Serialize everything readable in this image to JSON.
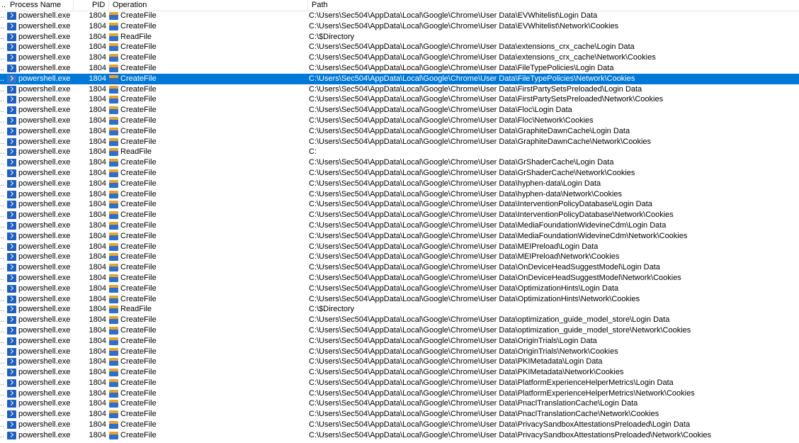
{
  "columns": {
    "process": "Process Name",
    "pid": "PID",
    "operation": "Operation",
    "path": "Path"
  },
  "rows": [
    {
      "process": "powershell.exe",
      "pid": "1804",
      "op": "CreateFile",
      "path": "C:\\Users\\Sec504\\AppData\\Local\\Google\\Chrome\\User Data\\EVWhitelist\\Login Data"
    },
    {
      "process": "powershell.exe",
      "pid": "1804",
      "op": "CreateFile",
      "path": "C:\\Users\\Sec504\\AppData\\Local\\Google\\Chrome\\User Data\\EVWhitelist\\Network\\Cookies"
    },
    {
      "process": "powershell.exe",
      "pid": "1804",
      "op": "ReadFile",
      "path": "C:\\$Directory"
    },
    {
      "process": "powershell.exe",
      "pid": "1804",
      "op": "CreateFile",
      "path": "C:\\Users\\Sec504\\AppData\\Local\\Google\\Chrome\\User Data\\extensions_crx_cache\\Login Data"
    },
    {
      "process": "powershell.exe",
      "pid": "1804",
      "op": "CreateFile",
      "path": "C:\\Users\\Sec504\\AppData\\Local\\Google\\Chrome\\User Data\\extensions_crx_cache\\Network\\Cookies"
    },
    {
      "process": "powershell.exe",
      "pid": "1804",
      "op": "CreateFile",
      "path": "C:\\Users\\Sec504\\AppData\\Local\\Google\\Chrome\\User Data\\FileTypePolicies\\Login Data"
    },
    {
      "process": "powershell.exe",
      "pid": "1804",
      "op": "CreateFile",
      "path": "C:\\Users\\Sec504\\AppData\\Local\\Google\\Chrome\\User Data\\FileTypePolicies\\Network\\Cookies",
      "selected": true
    },
    {
      "process": "powershell.exe",
      "pid": "1804",
      "op": "CreateFile",
      "path": "C:\\Users\\Sec504\\AppData\\Local\\Google\\Chrome\\User Data\\FirstPartySetsPreloaded\\Login Data"
    },
    {
      "process": "powershell.exe",
      "pid": "1804",
      "op": "CreateFile",
      "path": "C:\\Users\\Sec504\\AppData\\Local\\Google\\Chrome\\User Data\\FirstPartySetsPreloaded\\Network\\Cookies"
    },
    {
      "process": "powershell.exe",
      "pid": "1804",
      "op": "CreateFile",
      "path": "C:\\Users\\Sec504\\AppData\\Local\\Google\\Chrome\\User Data\\Floc\\Login Data"
    },
    {
      "process": "powershell.exe",
      "pid": "1804",
      "op": "CreateFile",
      "path": "C:\\Users\\Sec504\\AppData\\Local\\Google\\Chrome\\User Data\\Floc\\Network\\Cookies"
    },
    {
      "process": "powershell.exe",
      "pid": "1804",
      "op": "CreateFile",
      "path": "C:\\Users\\Sec504\\AppData\\Local\\Google\\Chrome\\User Data\\GraphiteDawnCache\\Login Data"
    },
    {
      "process": "powershell.exe",
      "pid": "1804",
      "op": "CreateFile",
      "path": "C:\\Users\\Sec504\\AppData\\Local\\Google\\Chrome\\User Data\\GraphiteDawnCache\\Network\\Cookies"
    },
    {
      "process": "powershell.exe",
      "pid": "1804",
      "op": "ReadFile",
      "path": "C:"
    },
    {
      "process": "powershell.exe",
      "pid": "1804",
      "op": "CreateFile",
      "path": "C:\\Users\\Sec504\\AppData\\Local\\Google\\Chrome\\User Data\\GrShaderCache\\Login Data"
    },
    {
      "process": "powershell.exe",
      "pid": "1804",
      "op": "CreateFile",
      "path": "C:\\Users\\Sec504\\AppData\\Local\\Google\\Chrome\\User Data\\GrShaderCache\\Network\\Cookies"
    },
    {
      "process": "powershell.exe",
      "pid": "1804",
      "op": "CreateFile",
      "path": "C:\\Users\\Sec504\\AppData\\Local\\Google\\Chrome\\User Data\\hyphen-data\\Login Data"
    },
    {
      "process": "powershell.exe",
      "pid": "1804",
      "op": "CreateFile",
      "path": "C:\\Users\\Sec504\\AppData\\Local\\Google\\Chrome\\User Data\\hyphen-data\\Network\\Cookies"
    },
    {
      "process": "powershell.exe",
      "pid": "1804",
      "op": "CreateFile",
      "path": "C:\\Users\\Sec504\\AppData\\Local\\Google\\Chrome\\User Data\\InterventionPolicyDatabase\\Login Data"
    },
    {
      "process": "powershell.exe",
      "pid": "1804",
      "op": "CreateFile",
      "path": "C:\\Users\\Sec504\\AppData\\Local\\Google\\Chrome\\User Data\\InterventionPolicyDatabase\\Network\\Cookies"
    },
    {
      "process": "powershell.exe",
      "pid": "1804",
      "op": "CreateFile",
      "path": "C:\\Users\\Sec504\\AppData\\Local\\Google\\Chrome\\User Data\\MediaFoundationWidevineCdm\\Login Data"
    },
    {
      "process": "powershell.exe",
      "pid": "1804",
      "op": "CreateFile",
      "path": "C:\\Users\\Sec504\\AppData\\Local\\Google\\Chrome\\User Data\\MediaFoundationWidevineCdm\\Network\\Cookies"
    },
    {
      "process": "powershell.exe",
      "pid": "1804",
      "op": "CreateFile",
      "path": "C:\\Users\\Sec504\\AppData\\Local\\Google\\Chrome\\User Data\\MEIPreload\\Login Data"
    },
    {
      "process": "powershell.exe",
      "pid": "1804",
      "op": "CreateFile",
      "path": "C:\\Users\\Sec504\\AppData\\Local\\Google\\Chrome\\User Data\\MEIPreload\\Network\\Cookies"
    },
    {
      "process": "powershell.exe",
      "pid": "1804",
      "op": "CreateFile",
      "path": "C:\\Users\\Sec504\\AppData\\Local\\Google\\Chrome\\User Data\\OnDeviceHeadSuggestModel\\Login Data"
    },
    {
      "process": "powershell.exe",
      "pid": "1804",
      "op": "CreateFile",
      "path": "C:\\Users\\Sec504\\AppData\\Local\\Google\\Chrome\\User Data\\OnDeviceHeadSuggestModel\\Network\\Cookies"
    },
    {
      "process": "powershell.exe",
      "pid": "1804",
      "op": "CreateFile",
      "path": "C:\\Users\\Sec504\\AppData\\Local\\Google\\Chrome\\User Data\\OptimizationHints\\Login Data"
    },
    {
      "process": "powershell.exe",
      "pid": "1804",
      "op": "CreateFile",
      "path": "C:\\Users\\Sec504\\AppData\\Local\\Google\\Chrome\\User Data\\OptimizationHints\\Network\\Cookies"
    },
    {
      "process": "powershell.exe",
      "pid": "1804",
      "op": "ReadFile",
      "path": "C:\\$Directory"
    },
    {
      "process": "powershell.exe",
      "pid": "1804",
      "op": "CreateFile",
      "path": "C:\\Users\\Sec504\\AppData\\Local\\Google\\Chrome\\User Data\\optimization_guide_model_store\\Login Data"
    },
    {
      "process": "powershell.exe",
      "pid": "1804",
      "op": "CreateFile",
      "path": "C:\\Users\\Sec504\\AppData\\Local\\Google\\Chrome\\User Data\\optimization_guide_model_store\\Network\\Cookies"
    },
    {
      "process": "powershell.exe",
      "pid": "1804",
      "op": "CreateFile",
      "path": "C:\\Users\\Sec504\\AppData\\Local\\Google\\Chrome\\User Data\\OriginTrials\\Login Data"
    },
    {
      "process": "powershell.exe",
      "pid": "1804",
      "op": "CreateFile",
      "path": "C:\\Users\\Sec504\\AppData\\Local\\Google\\Chrome\\User Data\\OriginTrials\\Network\\Cookies"
    },
    {
      "process": "powershell.exe",
      "pid": "1804",
      "op": "CreateFile",
      "path": "C:\\Users\\Sec504\\AppData\\Local\\Google\\Chrome\\User Data\\PKIMetadata\\Login Data"
    },
    {
      "process": "powershell.exe",
      "pid": "1804",
      "op": "CreateFile",
      "path": "C:\\Users\\Sec504\\AppData\\Local\\Google\\Chrome\\User Data\\PKIMetadata\\Network\\Cookies"
    },
    {
      "process": "powershell.exe",
      "pid": "1804",
      "op": "CreateFile",
      "path": "C:\\Users\\Sec504\\AppData\\Local\\Google\\Chrome\\User Data\\PlatformExperienceHelperMetrics\\Login Data"
    },
    {
      "process": "powershell.exe",
      "pid": "1804",
      "op": "CreateFile",
      "path": "C:\\Users\\Sec504\\AppData\\Local\\Google\\Chrome\\User Data\\PlatformExperienceHelperMetrics\\Network\\Cookies"
    },
    {
      "process": "powershell.exe",
      "pid": "1804",
      "op": "CreateFile",
      "path": "C:\\Users\\Sec504\\AppData\\Local\\Google\\Chrome\\User Data\\PnaclTranslationCache\\Login Data"
    },
    {
      "process": "powershell.exe",
      "pid": "1804",
      "op": "CreateFile",
      "path": "C:\\Users\\Sec504\\AppData\\Local\\Google\\Chrome\\User Data\\PnaclTranslationCache\\Network\\Cookies"
    },
    {
      "process": "powershell.exe",
      "pid": "1804",
      "op": "CreateFile",
      "path": "C:\\Users\\Sec504\\AppData\\Local\\Google\\Chrome\\User Data\\PrivacySandboxAttestationsPreloaded\\Login Data"
    },
    {
      "process": "powershell.exe",
      "pid": "1804",
      "op": "CreateFile",
      "path": "C:\\Users\\Sec504\\AppData\\Local\\Google\\Chrome\\User Data\\PrivacySandboxAttestationsPreloaded\\Network\\Cookies"
    }
  ],
  "colors": {
    "selection": "#0078d7",
    "header_border": "#e5e5e5"
  },
  "icons": {
    "process": "powershell-icon",
    "create": "createfile-icon",
    "read": "readfile-icon"
  }
}
